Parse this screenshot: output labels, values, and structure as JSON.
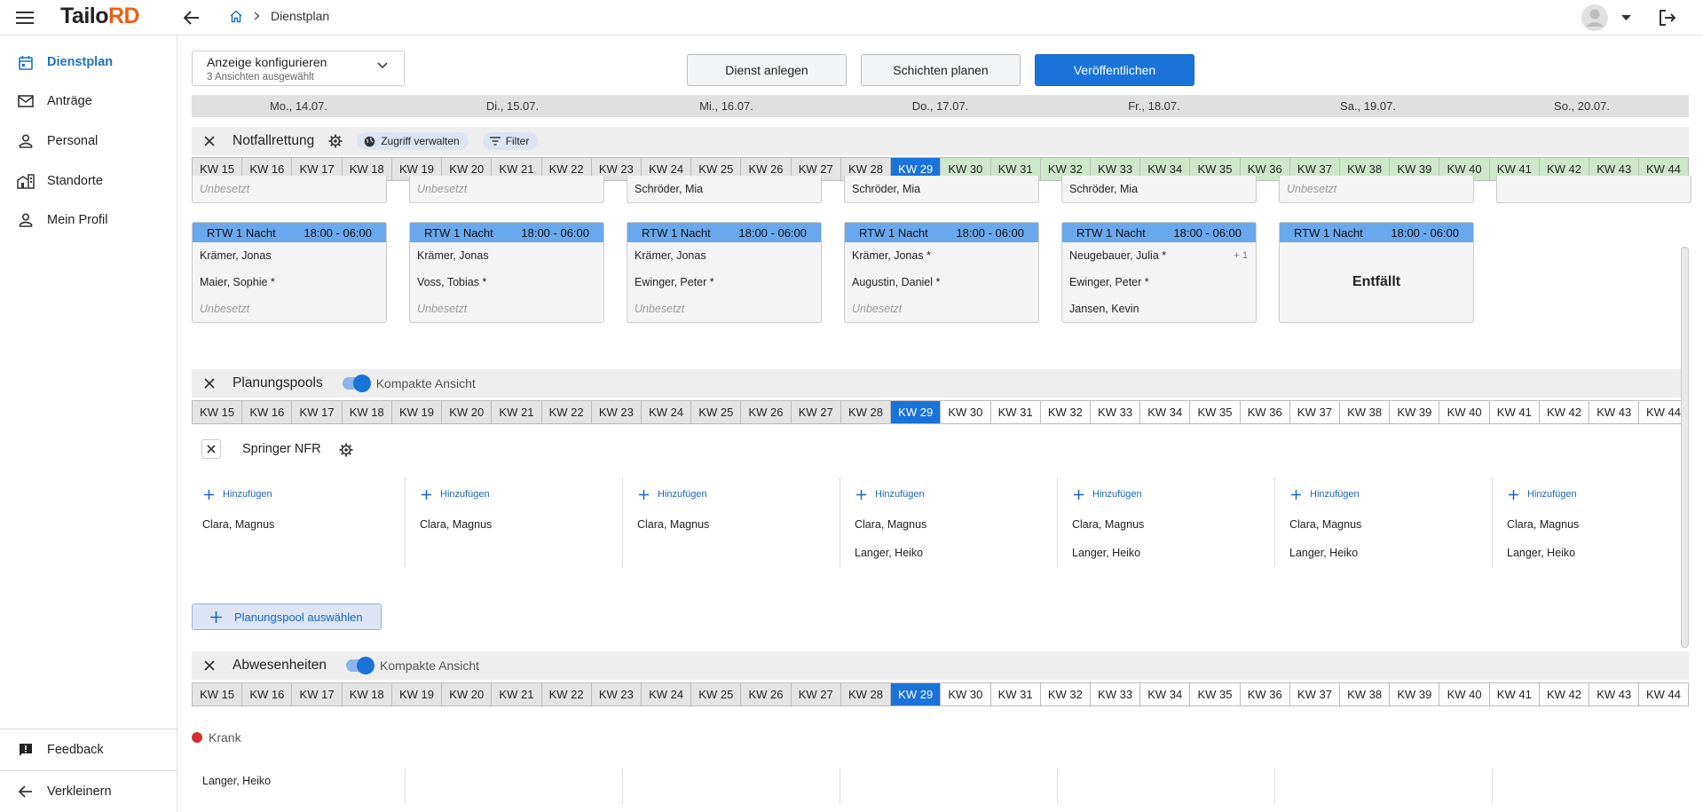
{
  "app": {
    "logo_main": "Tailo",
    "logo_accent": "RD"
  },
  "breadcrumb": {
    "current": "Dienstplan"
  },
  "sidebar": {
    "items": [
      {
        "label": "Dienstplan",
        "icon": "calendar-icon",
        "active": true
      },
      {
        "label": "Anträge",
        "icon": "mail-icon"
      },
      {
        "label": "Personal",
        "icon": "person-icon"
      },
      {
        "label": "Standorte",
        "icon": "building-icon"
      },
      {
        "label": "Mein Profil",
        "icon": "person-icon"
      }
    ],
    "feedback": "Feedback",
    "collapse": "Verkleinern"
  },
  "toolbar": {
    "config_title": "Anzeige konfigurieren",
    "config_sub": "3 Ansichten ausgewählt",
    "create_label": "Dienst anlegen",
    "plan_label": "Schichten planen",
    "publish_label": "Veröffentlichen"
  },
  "days": [
    "Mo., 14.07.",
    "Di., 15.07.",
    "Mi., 16.07.",
    "Do., 17.07.",
    "Fr., 18.07.",
    "Sa., 19.07.",
    "So., 20.07."
  ],
  "weeks": [
    "KW 15",
    "KW 16",
    "KW 17",
    "KW 18",
    "KW 19",
    "KW 20",
    "KW 21",
    "KW 22",
    "KW 23",
    "KW 24",
    "KW 25",
    "KW 26",
    "KW 27",
    "KW 28",
    "KW 29",
    "KW 30",
    "KW 31",
    "KW 32",
    "KW 33",
    "KW 34",
    "KW 35",
    "KW 36",
    "KW 37",
    "KW 38",
    "KW 39",
    "KW 40",
    "KW 41",
    "KW 42",
    "KW 43",
    "KW 44"
  ],
  "notfall": {
    "title": "Notfallrettung",
    "access": "Zugriff verwalten",
    "filter": "Filter",
    "prev_rows": [
      "Unbesetzt",
      "Unbesetzt",
      "Schröder, Mia",
      "Schröder, Mia",
      "Schröder, Mia",
      "Unbesetzt",
      ""
    ],
    "cards": [
      {
        "name": "RTW 1 Nacht",
        "time": "18:00 - 06:00",
        "rows": [
          "Krämer, Jonas",
          "Maier, Sophie *",
          "Unbesetzt"
        ]
      },
      {
        "name": "RTW 1 Nacht",
        "time": "18:00 - 06:00",
        "rows": [
          "Krämer, Jonas",
          "Voss, Tobias *",
          "Unbesetzt"
        ]
      },
      {
        "name": "RTW 1 Nacht",
        "time": "18:00 - 06:00",
        "rows": [
          "Krämer, Jonas",
          "Ewinger, Peter *",
          "Unbesetzt"
        ]
      },
      {
        "name": "RTW 1 Nacht",
        "time": "18:00 - 06:00",
        "rows": [
          "Krämer, Jonas *",
          "Augustin, Daniel *",
          "Unbesetzt"
        ]
      },
      {
        "name": "RTW 1 Nacht",
        "time": "18:00 - 06:00",
        "rows": [
          "Neugebauer, Julia *",
          "Ewinger, Peter *",
          "Jansen, Kevin"
        ],
        "extra": "+ 1"
      },
      {
        "name": "RTW 1 Nacht",
        "time": "18:00 - 06:00",
        "cancelled": "Entfällt"
      }
    ]
  },
  "pools": {
    "title": "Planungspools",
    "compact": "Kompakte Ansicht",
    "pool_name": "Springer NFR",
    "add_label": "Hinzufügen",
    "columns": [
      [
        "Clara, Magnus"
      ],
      [
        "Clara, Magnus"
      ],
      [
        "Clara, Magnus"
      ],
      [
        "Clara, Magnus",
        "Langer, Heiko"
      ],
      [
        "Clara, Magnus",
        "Langer, Heiko"
      ],
      [
        "Clara, Magnus",
        "Langer, Heiko"
      ],
      [
        "Clara, Magnus",
        "Langer, Heiko"
      ]
    ],
    "select_pool": "Planungspool auswählen"
  },
  "absences": {
    "title": "Abwesenheiten",
    "compact": "Kompakte Ansicht",
    "legend": "Krank",
    "legend_color": "#d32f2f",
    "row": [
      "Langer, Heiko",
      "",
      "",
      "",
      "",
      "",
      ""
    ]
  },
  "colors": {
    "accent": "#1a73d9",
    "current_week": "#1a73d9",
    "future_week_green": "#cce8c8",
    "card_header": "#6aa8ee"
  }
}
